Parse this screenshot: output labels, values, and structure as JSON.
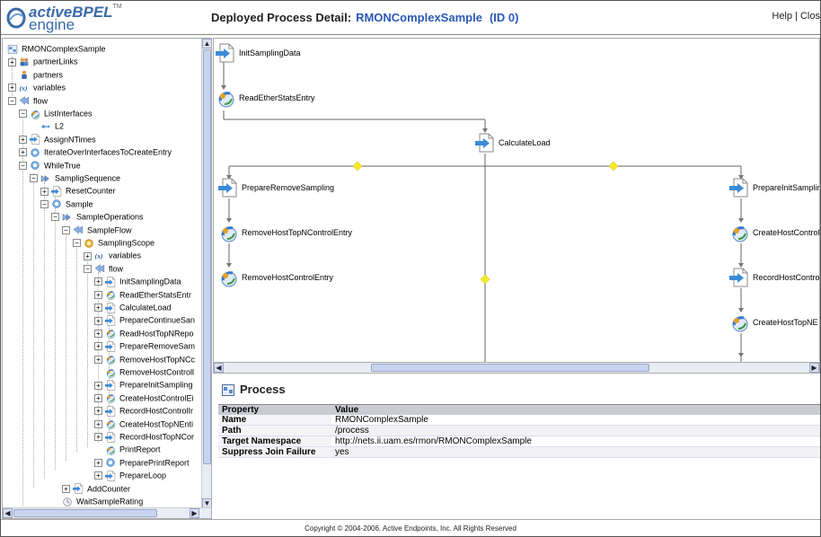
{
  "header": {
    "logo_active": "active",
    "logo_bpel": "BPEL",
    "logo_tm": "TM",
    "logo_engine": "engine",
    "title_label": "Deployed Process Detail:",
    "process_name": "RMONComplexSample",
    "process_id": "(ID 0)",
    "help_label": "Help",
    "separator": "|",
    "close_label": "Clos"
  },
  "tree": {
    "items": [
      {
        "label": "RMONComplexSample",
        "icon": "process-icon"
      },
      {
        "label": "partnerLinks",
        "icon": "partnerlinks-icon"
      },
      {
        "label": "partners",
        "icon": "partners-icon"
      },
      {
        "label": "variables",
        "icon": "variables-icon"
      },
      {
        "label": "flow",
        "icon": "flow-icon"
      },
      {
        "label": "ListInterfaces",
        "icon": "invoke-icon"
      },
      {
        "label": "L2",
        "icon": "link-icon"
      },
      {
        "label": "AssignNTimes",
        "icon": "assign-icon"
      },
      {
        "label": "IterateOverInterfacesToCreateEntry",
        "icon": "while-icon"
      },
      {
        "label": "WhileTrue",
        "icon": "while-icon"
      },
      {
        "label": "SampligSequence",
        "icon": "sequence-icon"
      },
      {
        "label": "ResetCounter",
        "icon": "assign-icon"
      },
      {
        "label": "Sample",
        "icon": "while-icon"
      },
      {
        "label": "SampleOperations",
        "icon": "sequence-icon"
      },
      {
        "label": "SampleFlow",
        "icon": "flow-icon"
      },
      {
        "label": "SamplingScope",
        "icon": "scope-icon"
      },
      {
        "label": "variables",
        "icon": "variables-icon"
      },
      {
        "label": "flow",
        "icon": "flow-icon"
      },
      {
        "label": "InitSamplingData",
        "icon": "assign-icon"
      },
      {
        "label": "ReadEtherStatsEntr",
        "icon": "invoke-icon"
      },
      {
        "label": "CalculateLoad",
        "icon": "assign-icon"
      },
      {
        "label": "PrepareContinueSan",
        "icon": "assign-icon"
      },
      {
        "label": "ReadHostTopNRepo",
        "icon": "invoke-icon"
      },
      {
        "label": "PrepareRemoveSam",
        "icon": "assign-icon"
      },
      {
        "label": "RemoveHostTopNCc",
        "icon": "invoke-icon"
      },
      {
        "label": "RemoveHostControll",
        "icon": "invoke-icon"
      },
      {
        "label": "PrepareInitSampling",
        "icon": "assign-icon"
      },
      {
        "label": "CreateHostControlEi",
        "icon": "invoke-icon"
      },
      {
        "label": "RecordHostControlIr",
        "icon": "assign-icon"
      },
      {
        "label": "CreateHostTopNEnti",
        "icon": "invoke-icon"
      },
      {
        "label": "RecordHostTopNCor",
        "icon": "assign-icon"
      },
      {
        "label": "PrintReport",
        "icon": "invoke-icon"
      },
      {
        "label": "PreparePrintReport",
        "icon": "while-icon"
      },
      {
        "label": "PrepareLoop",
        "icon": "assign-icon"
      },
      {
        "label": "AddCounter",
        "icon": "assign-icon"
      },
      {
        "label": "WaitSampleRating",
        "icon": "wait-icon"
      }
    ]
  },
  "diagram": {
    "activities": [
      {
        "label": "InitSamplingData",
        "icon": "assign-icon"
      },
      {
        "label": "ReadEtherStatsEntry",
        "icon": "invoke-icon"
      },
      {
        "label": "CalculateLoad",
        "icon": "assign-icon"
      },
      {
        "label": "PrepareRemoveSampling",
        "icon": "assign-icon"
      },
      {
        "label": "RemoveHostTopNControlEntry",
        "icon": "invoke-icon"
      },
      {
        "label": "RemoveHostControlEntry",
        "icon": "invoke-icon"
      },
      {
        "label": "PrepareInitSamplir",
        "icon": "assign-icon"
      },
      {
        "label": "CreateHostControl",
        "icon": "invoke-icon"
      },
      {
        "label": "RecordHostContro",
        "icon": "assign-icon"
      },
      {
        "label": "CreateHostTopNE",
        "icon": "invoke-icon"
      }
    ]
  },
  "properties": {
    "title": "Process",
    "col_property": "Property",
    "col_value": "Value",
    "rows": [
      {
        "key": "Name",
        "value": "RMONComplexSample"
      },
      {
        "key": "Path",
        "value": "/process"
      },
      {
        "key": "Target Namespace",
        "value": "http://nets.ii.uam.es/rmon/RMONComplexSample"
      },
      {
        "key": "Suppress Join Failure",
        "value": "yes"
      }
    ]
  },
  "footer": {
    "copyright": "Copyright © 2004-2006. Active Endpoints, Inc. All Rights Reserved"
  },
  "colors": {
    "accent": "#2a58b8",
    "header_row": "#c9ccd3",
    "connector_diamond": "#f5e82a"
  }
}
